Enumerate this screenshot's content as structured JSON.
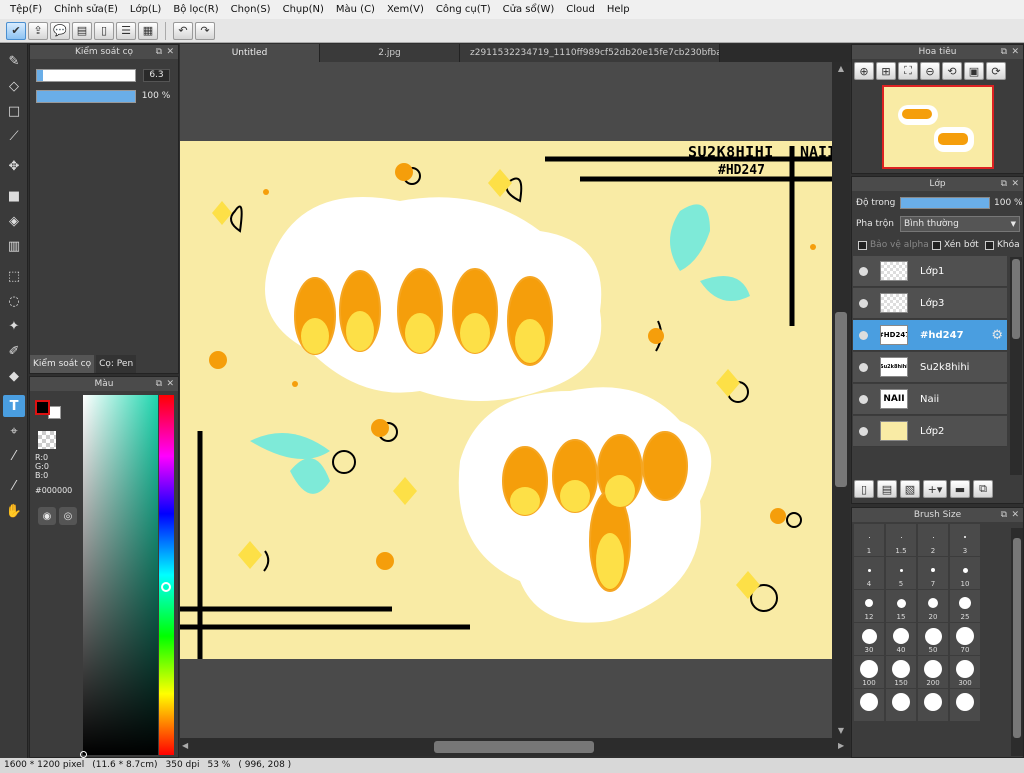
{
  "menu": [
    "Tệp(F)",
    "Chỉnh sửa(E)",
    "Lớp(L)",
    "Bộ lọc(R)",
    "Chọn(S)",
    "Chụp(N)",
    "Màu (C)",
    "Xem(V)",
    "Công cụ(T)",
    "Cửa sổ(W)",
    "Cloud",
    "Help"
  ],
  "tabs": [
    "Untitled",
    "2.jpg",
    "z2911532234719_1110ff989cf52db20e15fe7cb230bfba.jpg"
  ],
  "brush_control": {
    "title": "Kiểm soát cọ",
    "size_value": "6.3",
    "opacity_value": "100 %",
    "size_level_pct": 6,
    "opacity_level_pct": 100,
    "tab1": "Kiểm soát cọ",
    "tab2": "Cọ: Pen"
  },
  "color": {
    "title": "Màu",
    "r": "R:0",
    "g": "G:0",
    "b": "B:0",
    "hex": "#000000",
    "foreground": "#000000",
    "background": "#ffffff"
  },
  "artwork": {
    "text1": "SU2K8HIHI",
    "text2": "NAII",
    "text3": "#HD247",
    "bg_color": "#f9eba5",
    "accent_orange": "#f59e0b",
    "accent_teal": "#7eead8"
  },
  "navigator": {
    "title": "Hoa tiêu"
  },
  "layers": {
    "title": "Lớp",
    "opacity_label": "Độ trong",
    "opacity_value": "100 %",
    "blend_label": "Pha trộn",
    "blend_value": "Bình thường",
    "protect_alpha": "Bảo vệ alpha",
    "clip": "Xén bớt",
    "lock": "Khóa",
    "items": [
      {
        "name": "Lớp1",
        "thumb": ""
      },
      {
        "name": "Lớp3",
        "thumb": ""
      },
      {
        "name": "#hd247",
        "thumb": "#HD247"
      },
      {
        "name": "Su2k8hihi",
        "thumb": "Su2k8hihi"
      },
      {
        "name": "Naii",
        "thumb": "NAII"
      },
      {
        "name": "Lớp2",
        "thumb": ""
      }
    ]
  },
  "brush_size": {
    "title": "Brush Size",
    "sizes": [
      "1",
      "1.5",
      "2",
      "3",
      "4",
      "5",
      "7",
      "10",
      "12",
      "15",
      "20",
      "25",
      "30",
      "40",
      "50",
      "70",
      "100",
      "150",
      "200",
      "300",
      "",
      "",
      "",
      ""
    ]
  },
  "status": {
    "dimensions": "1600 * 1200 pixel",
    "physical": "(11.6 * 8.7cm)",
    "dpi": "350 dpi",
    "zoom": "53 %",
    "coords": "( 996, 208 )"
  }
}
